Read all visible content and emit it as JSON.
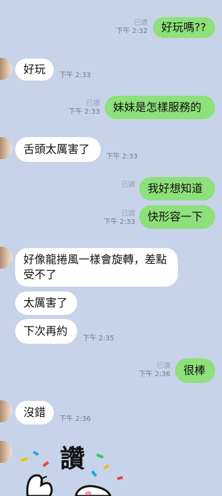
{
  "messages": [
    {
      "dir": "out",
      "text": "好玩嗎??",
      "read": "已讀",
      "time": "下午 2:32"
    },
    {
      "dir": "in",
      "text": "好玩",
      "time": "下午 2:33"
    },
    {
      "dir": "out",
      "text": "妹妹是怎樣服務的",
      "read": "已讀",
      "time": "下午 2:33"
    },
    {
      "dir": "in",
      "text": "舌頭太厲害了",
      "time": "下午 2:33"
    },
    {
      "dir": "out",
      "text": "我好想知道",
      "read": "已讀"
    },
    {
      "dir": "out",
      "text": "快形容一下",
      "read": "已讀",
      "time": "下午 2:33"
    },
    {
      "dir": "in",
      "text": "好像龍捲風一樣會旋轉，差點受不了"
    },
    {
      "dir": "in",
      "text": "太厲害了"
    },
    {
      "dir": "in",
      "text": "下次再約",
      "time": "下午 2:35"
    },
    {
      "dir": "out",
      "text": "很棒",
      "read": "已讀",
      "time": "下午 2:36"
    },
    {
      "dir": "in",
      "text": "沒錯",
      "time": "下午 2:36"
    }
  ],
  "sticker": {
    "text": "讚",
    "icon": "bunny-like-sticker-icon"
  },
  "colors": {
    "background": "#c6d3e8",
    "outgoing_bubble": "#8de07a",
    "incoming_bubble": "#ffffff",
    "meta_text": "#6f7a8b"
  }
}
